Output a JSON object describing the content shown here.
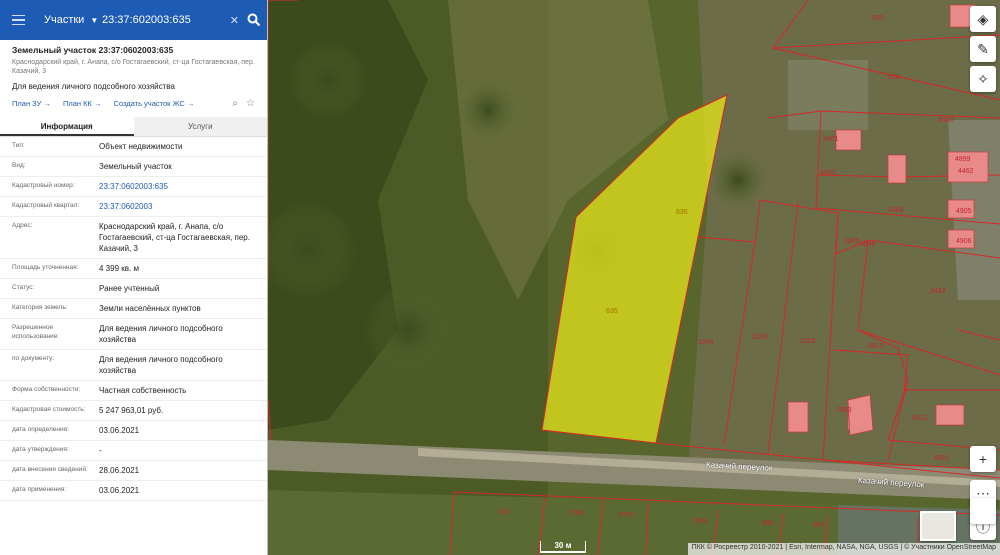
{
  "search": {
    "category": "Участки",
    "query": "23:37:602003:635"
  },
  "parcel": {
    "title": "Земельный участок 23:37:0602003:635",
    "address_short": "Краснодарский край, г. Анапа, с/о Гостагаевский, ст-ца Гостагаевская, пер. Казачий, 3",
    "use": "Для ведения личного подсобного хозяйства"
  },
  "links": {
    "plan_zu": "План ЗУ →",
    "plan_kk": "План КК →",
    "create_zs": "Создать участок ЖС →"
  },
  "tabs": {
    "info": "Информация",
    "services": "Услуги"
  },
  "info": {
    "type": {
      "k": "Тип:",
      "v": "Объект недвижимости"
    },
    "kind": {
      "k": "Вид:",
      "v": "Земельный участок"
    },
    "cad_num": {
      "k": "Кадастровый номер:",
      "v": "23:37:0602003:635"
    },
    "cad_block": {
      "k": "Кадастровый квартал:",
      "v": "23:37:0602003"
    },
    "address": {
      "k": "Адрес:",
      "v": "Краснодарский край, г. Анапа, с/о Гостагаевский, ст-ца Гостагаевская, пер. Казачий, 3"
    },
    "area": {
      "k": "Площадь уточненная:",
      "v": "4 399 кв. м"
    },
    "status": {
      "k": "Статус:",
      "v": "Ранее учтенный"
    },
    "category": {
      "k": "Категория земель:",
      "v": "Земли населённых пунктов"
    },
    "permitted": {
      "k": "Разрешенное использование:",
      "v": "Для ведения личного подсобного хозяйства"
    },
    "by_doc": {
      "k": "по документу:",
      "v": "Для ведения личного подсобного хозяйства"
    },
    "ownership": {
      "k": "Форма собственности:",
      "v": "Частная собственность"
    },
    "cost": {
      "k": "Кадастровая стоимость:",
      "v": "5 247 963,01 руб."
    },
    "date_def": {
      "k": "дата определения:",
      "v": "03.06.2021"
    },
    "date_appr": {
      "k": "дата утверждения:",
      "v": "-"
    },
    "date_entry": {
      "k": "дата внесения сведений:",
      "v": "28.06.2021"
    },
    "date_apply": {
      "k": "дата применения:",
      "v": "03.06.2021"
    }
  },
  "map": {
    "labels": {
      "l903": "903",
      "l850": "850",
      "l4900": "4900",
      "l4901": "4901",
      "l4902": "4902",
      "l4899": "4899",
      "l4462": "4462",
      "l4368": "4368",
      "l4905": "4905",
      "l4906": "4906",
      "l3845": "3845",
      "l4948": "4948",
      "l3434": "3434",
      "l635a": "635",
      "l635b": "635",
      "l1044": "1044",
      "l1029": "1029",
      "l1026": "1026",
      "l3613": "3613",
      "l2603": "2603",
      "l4512": "4512",
      "l4511": "4511",
      "l632": "632",
      "l2768": "2768",
      "l2767": "2767",
      "l2563": "2563",
      "l893": "893",
      "l897": "897"
    },
    "road1": "Казачий переулок",
    "road2": "Казачий переулок",
    "scale": "30 м",
    "attribution": "ПКК © Росреестр 2010-2021 | Esri, Intermap, NASA, NGA, USGS | © Участники OpenStreetMap"
  },
  "colors": {
    "header": "#1e5bb5",
    "parcel_fill": "#e6e619",
    "boundary": "#d62828"
  }
}
